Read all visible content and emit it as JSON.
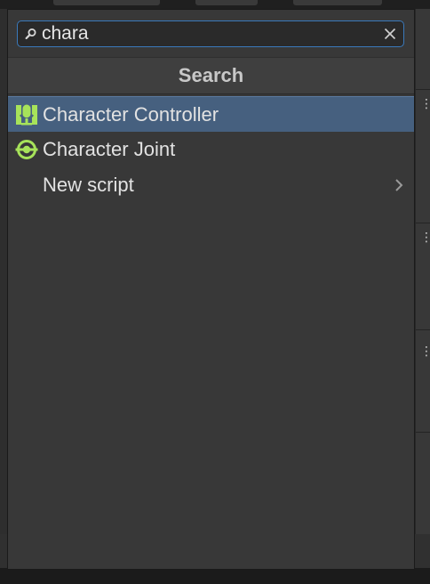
{
  "search": {
    "value": "chara",
    "icon": "search-icon",
    "clear_icon": "close-icon"
  },
  "header": {
    "title": "Search"
  },
  "results": [
    {
      "label": "Character Controller",
      "icon": "character-controller-icon",
      "selected": true,
      "has_submenu": false
    },
    {
      "label": "Character Joint",
      "icon": "character-joint-icon",
      "selected": false,
      "has_submenu": false
    },
    {
      "label": "New script",
      "icon": "",
      "selected": false,
      "has_submenu": true
    }
  ],
  "colors": {
    "selection": "#46607f",
    "focus_border": "#3a79bb",
    "icon_green": "#a7e35a"
  }
}
